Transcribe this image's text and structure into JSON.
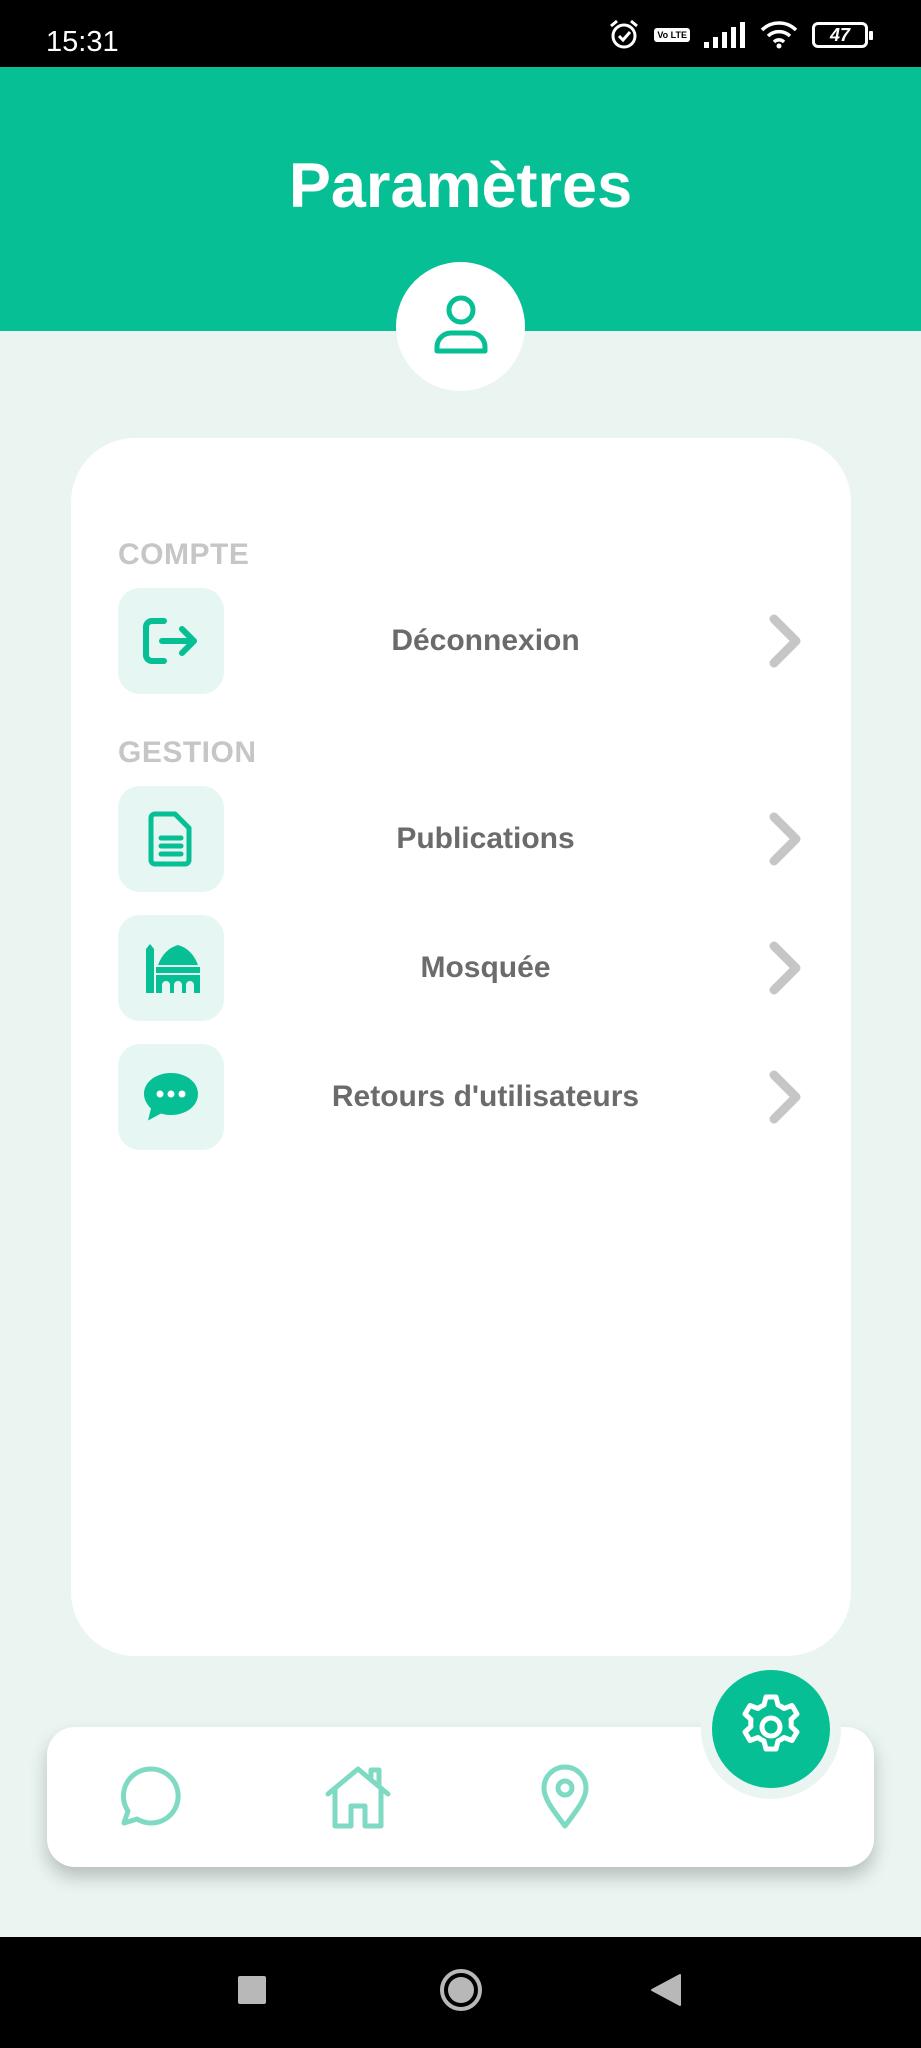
{
  "status_bar": {
    "time": "15:31",
    "lte_badge": "Vo LTE",
    "battery": "47"
  },
  "header": {
    "title": "Paramètres"
  },
  "settings": {
    "sections": [
      {
        "label": "COMPTE",
        "items": [
          {
            "label": "Déconnexion",
            "icon": "logout-icon"
          }
        ]
      },
      {
        "label": "GESTION",
        "items": [
          {
            "label": "Publications",
            "icon": "document-icon"
          },
          {
            "label": "Mosquée",
            "icon": "mosque-icon"
          },
          {
            "label": "Retours d'utilisateurs",
            "icon": "chat-bubble-icon"
          }
        ]
      }
    ]
  },
  "bottom_nav": {
    "items": [
      "chat-icon",
      "home-icon",
      "location-pin-icon",
      "settings-gear-icon"
    ],
    "active": "settings-gear-icon"
  },
  "colors": {
    "accent": "#06bf94",
    "background": "#eaf4f1",
    "icon_tile": "#e6f6f2",
    "section_label": "#c6c6c6",
    "item_text": "#6b6b6b"
  }
}
